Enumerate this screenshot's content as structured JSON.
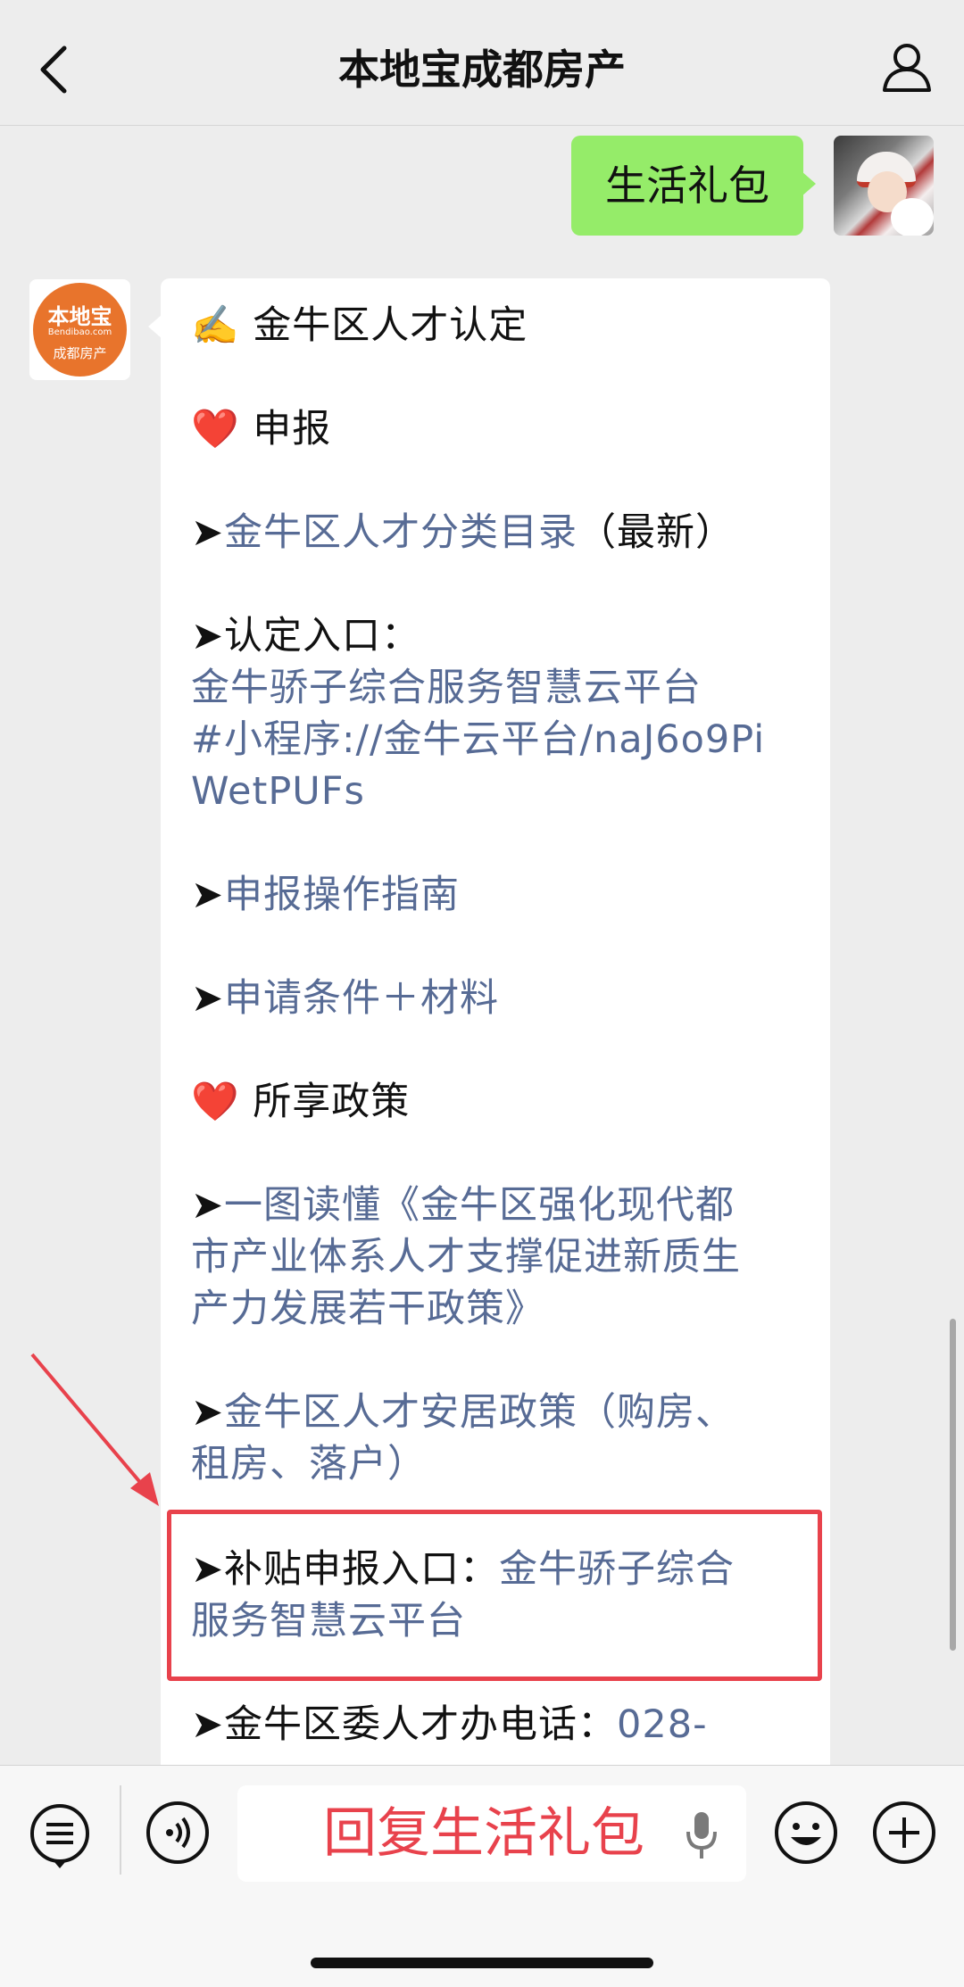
{
  "header": {
    "title": "本地宝成都房产",
    "back_icon": "chevron-left-icon",
    "profile_icon": "person-icon"
  },
  "outgoing": {
    "text": "生活礼包"
  },
  "bot_avatar": {
    "logo_main": "本地宝",
    "logo_site": "Bendibao.com",
    "logo_sub": "成都房产"
  },
  "message": {
    "heading": {
      "emoji": "✍️",
      "text": "金牛区人才认定"
    },
    "section1": {
      "emoji": "❤️",
      "text": "申报"
    },
    "item_catalog": {
      "arrow": "➤",
      "link": "金牛区人才分类目录",
      "suffix": "（最新）"
    },
    "item_entry": {
      "arrow": "➤",
      "label": "认定入口：",
      "link_line1": "金牛骄子综合服务智慧云平台",
      "link_line2": "#小程序://金牛云平台/naJ6o9Pi",
      "link_line3": "WetPUFs"
    },
    "item_guide": {
      "arrow": "➤",
      "link": "申报操作指南"
    },
    "item_conditions": {
      "arrow": "➤",
      "link": "申请条件＋材料"
    },
    "section2": {
      "emoji": "❤️",
      "text": "所享政策"
    },
    "item_policy": {
      "arrow": "➤",
      "line1": "一图读懂《金牛区强化现代都",
      "line2": "市产业体系人才支撑促进新质生",
      "line3": "产力发展若干政策》"
    },
    "item_housing": {
      "arrow": "➤",
      "line1": "金牛区人才安居政策（购房、",
      "line2": "租房、落户）"
    },
    "item_subsidy": {
      "arrow": "➤",
      "label": "补贴申报入口：",
      "link_line1": "金牛骄子综合",
      "link_line2": "服务智慧云平台"
    },
    "item_phone": {
      "arrow": "➤",
      "label": "金牛区委人才办电话：",
      "link": "028-"
    }
  },
  "input_bar": {
    "placeholder_text": "回复生活礼包",
    "icons": [
      "menu-list-icon",
      "voice-icon",
      "mic-icon",
      "emoji-icon",
      "plus-icon"
    ]
  },
  "colors": {
    "background": "#ededed",
    "outgoing_bubble": "#95ec69",
    "link": "#576b95",
    "highlight": "#e8424c"
  }
}
